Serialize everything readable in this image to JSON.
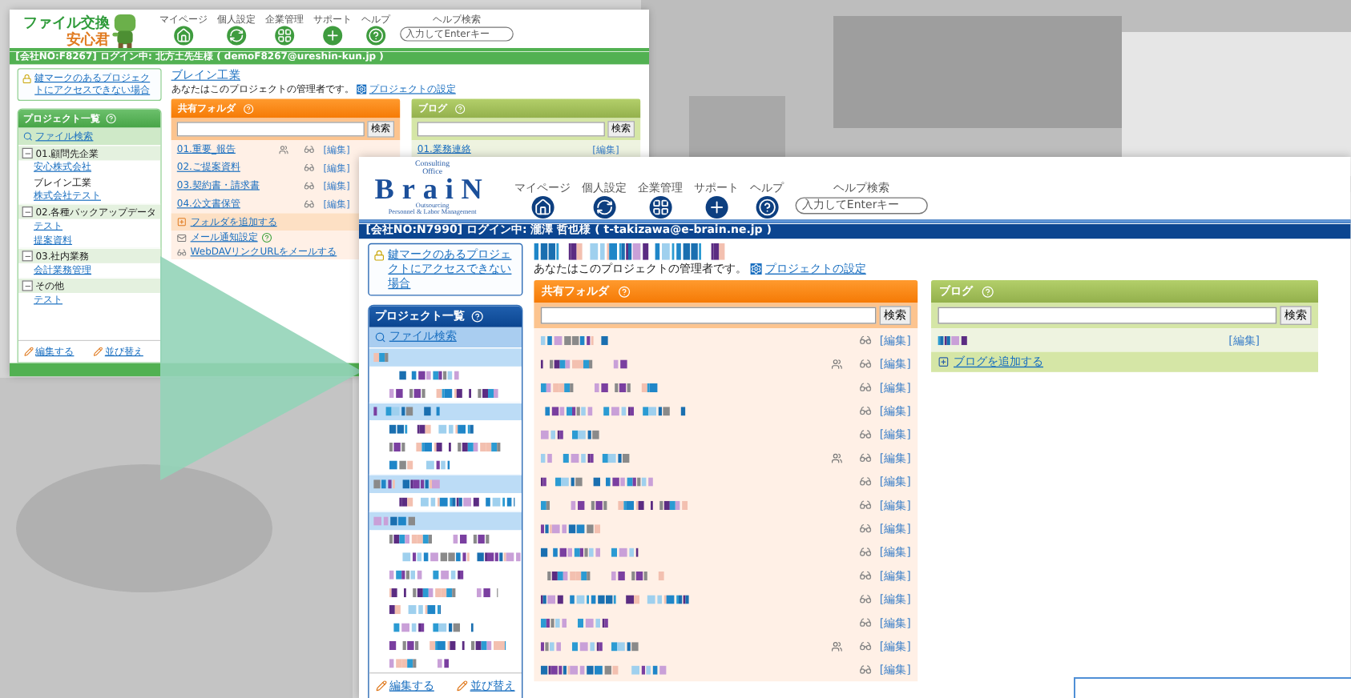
{
  "back_window": {
    "logo": {
      "kind": "mascot",
      "title": "ファイル交換",
      "subtitle": "安心君"
    },
    "nav": [
      {
        "label": "マイページ"
      },
      {
        "label": "個人設定"
      },
      {
        "label": "企業管理"
      },
      {
        "label": "サポート"
      },
      {
        "label": "ヘルプ"
      }
    ],
    "help_search": {
      "label": "ヘルプ検索",
      "placeholder": "入力してEnterキー"
    },
    "status_bar": "[会社NO:F8267] ログイン中: 北方土先生様 ( demoF8267@ureshin-kun.jp )",
    "lock_link": "鍵マークのあるプロジェクトにアクセスできない場合",
    "sidebar": {
      "title": "プロジェクト一覧",
      "file_search": "ファイル検索",
      "entries": [
        {
          "kind": "group",
          "label": "01.顧問先企業",
          "expanded": true,
          "children": [
            {
              "label": "安心株式会社",
              "selected": false
            },
            {
              "label": "ブレイン工業",
              "selected": true
            },
            {
              "label": "株式会社テスト",
              "selected": false
            }
          ]
        },
        {
          "kind": "group",
          "label": "02.各種バックアップデータ",
          "expanded": true,
          "children": [
            {
              "label": "テスト",
              "selected": false
            },
            {
              "label": "提案資料",
              "selected": false
            }
          ]
        },
        {
          "kind": "group",
          "label": "03.社内業務",
          "expanded": true,
          "children": [
            {
              "label": "会計業務管理",
              "selected": false
            }
          ]
        },
        {
          "kind": "group",
          "label": "その他",
          "expanded": true,
          "children": [
            {
              "label": "テスト",
              "selected": false
            }
          ]
        }
      ],
      "footer_links": [
        "編集する",
        "並び替え"
      ]
    },
    "project": {
      "title": "ブレイン工業",
      "admin_note": "あなたはこのプロジェクトの管理者です。",
      "settings_link": "プロジェクトの設定"
    },
    "folders": {
      "title": "共有フォルダ",
      "search_button": "検索",
      "rows": [
        {
          "kind": "link",
          "name": "01.重要_報告",
          "marked": true,
          "edit": "[編集]"
        },
        {
          "kind": "link",
          "name": "02.ご提案資料",
          "marked": false,
          "edit": "[編集]"
        },
        {
          "kind": "link",
          "name": "03.契約書・請求書",
          "marked": false,
          "edit": "[編集]"
        },
        {
          "kind": "link",
          "name": "04.公文書保管",
          "marked": false,
          "edit": "[編集]"
        }
      ],
      "add_link": "フォルダを追加する",
      "mail_link": "メール通知設定",
      "webdav_link": "WebDAVリンクURLをメールする"
    },
    "blog": {
      "title": "ブログ",
      "search_button": "検索",
      "rows": [
        {
          "kind": "link",
          "name": "01.業務連絡",
          "edit": "[編集]"
        }
      ]
    }
  },
  "front_window": {
    "logo": {
      "kind": "brain",
      "top": "Consulting Office",
      "name": "BraiN",
      "tagline": "Outsourcing",
      "subline": "Personnel & Labor Management"
    },
    "nav": [
      {
        "label": "マイページ"
      },
      {
        "label": "個人設定"
      },
      {
        "label": "企業管理"
      },
      {
        "label": "サポート"
      },
      {
        "label": "ヘルプ"
      }
    ],
    "help_search": {
      "label": "ヘルプ検索",
      "placeholder": "入力してEnterキー"
    },
    "status_bar": "[会社NO:N7990] ログイン中: 瀧澤 哲也様 ( t-takizawa@e-brain.ne.jp )",
    "lock_link": "鍵マークのあるプロジェクトにアクセスできない場合",
    "sidebar": {
      "title": "プロジェクト一覧",
      "file_search": "ファイル検索",
      "entries": [
        {
          "kind": "mosaic-group"
        },
        {
          "kind": "mosaic"
        },
        {
          "kind": "mosaic"
        },
        {
          "kind": "mosaic-group"
        },
        {
          "kind": "mosaic"
        },
        {
          "kind": "mosaic"
        },
        {
          "kind": "mosaic"
        },
        {
          "kind": "mosaic-group"
        },
        {
          "kind": "mosaic"
        },
        {
          "kind": "mosaic-group"
        },
        {
          "kind": "mosaic"
        },
        {
          "kind": "mosaic"
        },
        {
          "kind": "mosaic"
        },
        {
          "kind": "mosaic"
        },
        {
          "kind": "mosaic"
        },
        {
          "kind": "mosaic"
        },
        {
          "kind": "mosaic"
        },
        {
          "kind": "mosaic"
        }
      ],
      "footer_links": [
        "編集する",
        "並び替え"
      ]
    },
    "project": {
      "admin_note": "あなたはこのプロジェクトの管理者です。",
      "settings_link": "プロジェクトの設定"
    },
    "folders": {
      "title": "共有フォルダ",
      "search_button": "検索",
      "rows": [
        {
          "kind": "mosaic",
          "marked": false,
          "edit": "[編集]"
        },
        {
          "kind": "mosaic",
          "marked": true,
          "edit": "[編集]"
        },
        {
          "kind": "mosaic",
          "marked": false,
          "edit": "[編集]"
        },
        {
          "kind": "mosaic",
          "marked": false,
          "edit": "[編集]"
        },
        {
          "kind": "mosaic",
          "marked": false,
          "edit": "[編集]"
        },
        {
          "kind": "mosaic",
          "marked": true,
          "edit": "[編集]"
        },
        {
          "kind": "mosaic",
          "marked": false,
          "edit": "[編集]"
        },
        {
          "kind": "mosaic",
          "marked": false,
          "edit": "[編集]"
        },
        {
          "kind": "mosaic",
          "marked": false,
          "edit": "[編集]"
        },
        {
          "kind": "mosaic",
          "marked": false,
          "edit": "[編集]"
        },
        {
          "kind": "mosaic",
          "marked": false,
          "edit": "[編集]"
        },
        {
          "kind": "mosaic",
          "marked": false,
          "edit": "[編集]"
        },
        {
          "kind": "mosaic",
          "marked": false,
          "edit": "[編集]"
        },
        {
          "kind": "mosaic",
          "marked": true,
          "edit": "[編集]"
        },
        {
          "kind": "mosaic",
          "marked": false,
          "edit": "[編集]"
        }
      ]
    },
    "blog": {
      "title": "ブログ",
      "search_button": "検索",
      "rows": [
        {
          "kind": "mosaic",
          "edit": "[編集]"
        }
      ],
      "add_link": "ブログを追加する"
    }
  }
}
